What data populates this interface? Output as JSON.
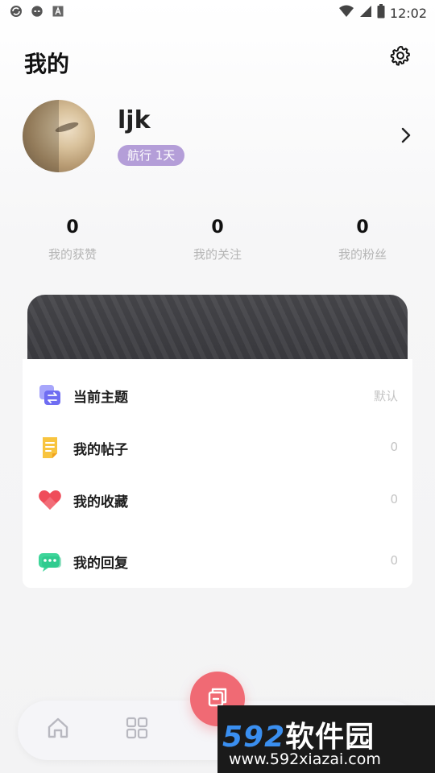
{
  "status_bar": {
    "time": "12:02",
    "left_icons": [
      "sync-icon",
      "link-icon",
      "font-icon"
    ],
    "right_icons": [
      "wifi-icon",
      "signal-icon",
      "battery-icon"
    ]
  },
  "header": {
    "title": "我的",
    "settings_icon": "gear-icon"
  },
  "profile": {
    "username": "ljk",
    "badge": "航行 1天",
    "badge_color": "#b49ed8"
  },
  "stats": [
    {
      "value": "0",
      "label": "我的获赞"
    },
    {
      "value": "0",
      "label": "我的关注"
    },
    {
      "value": "0",
      "label": "我的粉丝"
    }
  ],
  "menu": [
    {
      "label": "当前主题",
      "value": "默认",
      "icon": "theme-icon",
      "color": "#7e7cf5"
    },
    {
      "label": "我的帖子",
      "value": "0",
      "icon": "document-icon",
      "color": "#f7bf3a"
    },
    {
      "label": "我的收藏",
      "value": "0",
      "icon": "heart-icon",
      "color": "#ef4d5a"
    },
    {
      "label": "我的回复",
      "value": "0",
      "icon": "chat-icon",
      "color": "#3ed59a"
    }
  ],
  "tab_bar": {
    "tabs": [
      "home-icon",
      "grid-icon"
    ],
    "fab_icon": "post-icon",
    "fab_color": "#f06a74"
  },
  "watermark": {
    "number": "592",
    "brand": "软件园",
    "url": "www.592xiazai.com"
  }
}
